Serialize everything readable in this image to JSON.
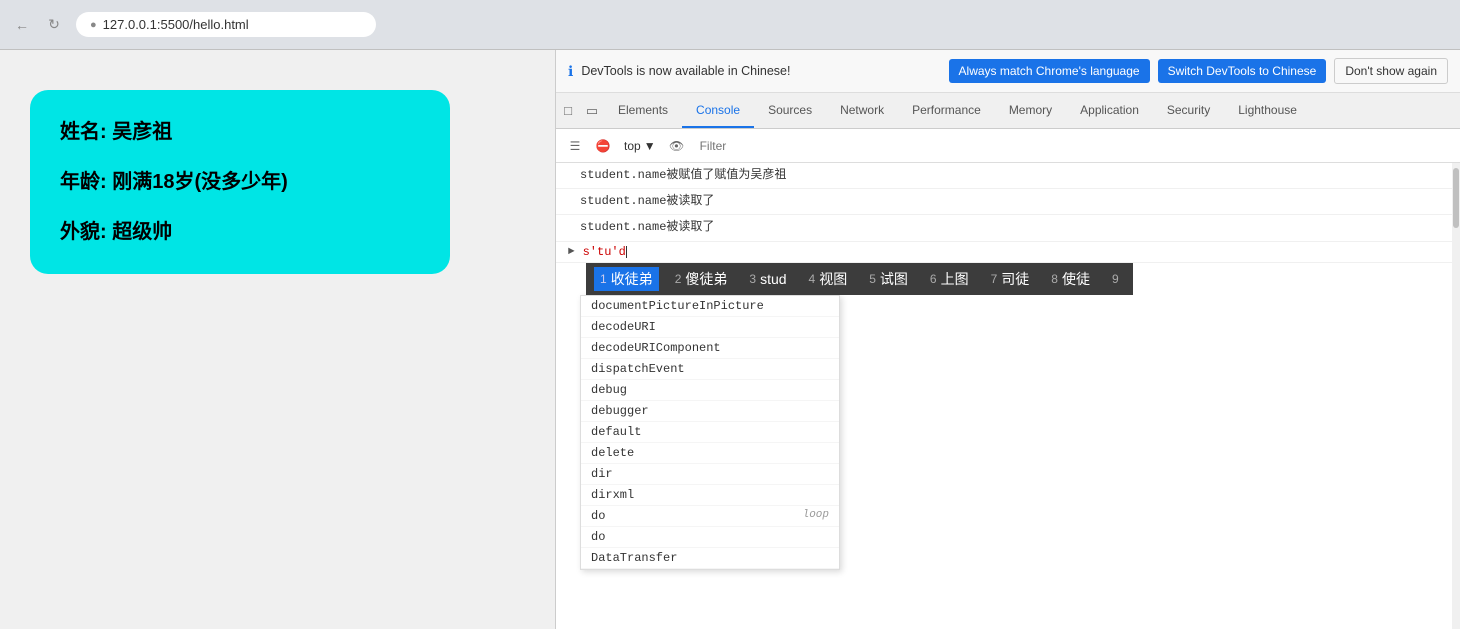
{
  "browser": {
    "url": "127.0.0.1:5500/hello.html",
    "url_full": "127.0.0.1:5500/hello.html"
  },
  "notification": {
    "icon": "ℹ",
    "text": "DevTools is now available in Chinese!",
    "btn1": "Always match Chrome's language",
    "btn2": "Switch DevTools to Chinese",
    "btn3": "Don't show again"
  },
  "devtools_tabs": [
    {
      "label": "Elements",
      "active": false
    },
    {
      "label": "Console",
      "active": true
    },
    {
      "label": "Sources",
      "active": false
    },
    {
      "label": "Network",
      "active": false
    },
    {
      "label": "Performance",
      "active": false
    },
    {
      "label": "Memory",
      "active": false
    },
    {
      "label": "Application",
      "active": false
    },
    {
      "label": "Security",
      "active": false
    },
    {
      "label": "Lighthouse",
      "active": false
    }
  ],
  "console": {
    "top_selector": "top",
    "filter_placeholder": "Filter",
    "lines": [
      {
        "text": "student.name被赋值了赋值为吴彦祖"
      },
      {
        "text": "student.name被读取了"
      },
      {
        "text": "student.name被读取了"
      },
      {
        "text": "s'tu'd"
      }
    ]
  },
  "ime": {
    "items": [
      {
        "num": "1",
        "text": "收徒弟",
        "selected": true
      },
      {
        "num": "2",
        "text": "傻徒弟"
      },
      {
        "num": "3",
        "text": "stud"
      },
      {
        "num": "4",
        "text": "视图"
      },
      {
        "num": "5",
        "text": "试图"
      },
      {
        "num": "6",
        "text": "上图"
      },
      {
        "num": "7",
        "text": "司徒"
      },
      {
        "num": "8",
        "text": "使徒"
      },
      {
        "num": "9",
        "text": ""
      }
    ]
  },
  "autocomplete": {
    "items": [
      {
        "text": "documentPictureInPicture",
        "loop": ""
      },
      {
        "text": "decodeURI",
        "loop": ""
      },
      {
        "text": "decodeURIComponent",
        "loop": ""
      },
      {
        "text": "dispatchEvent",
        "loop": ""
      },
      {
        "text": "debug",
        "loop": ""
      },
      {
        "text": "debugger",
        "loop": ""
      },
      {
        "text": "default",
        "loop": ""
      },
      {
        "text": "delete",
        "loop": ""
      },
      {
        "text": "dir",
        "loop": ""
      },
      {
        "text": "dirxml",
        "loop": ""
      },
      {
        "text": "do",
        "loop": "loop"
      },
      {
        "text": "do",
        "loop": ""
      },
      {
        "text": "DataTransfer",
        "loop": ""
      }
    ]
  },
  "page_content": {
    "name_label": "姓名: 吴彦祖",
    "age_label": "年龄: 刚满18岁(没多少年)",
    "looks_label": "外貌: 超级帅"
  },
  "colors": {
    "card_bg": "#00e5e5",
    "active_tab": "#1a73e8",
    "btn_blue": "#1a73e8"
  }
}
